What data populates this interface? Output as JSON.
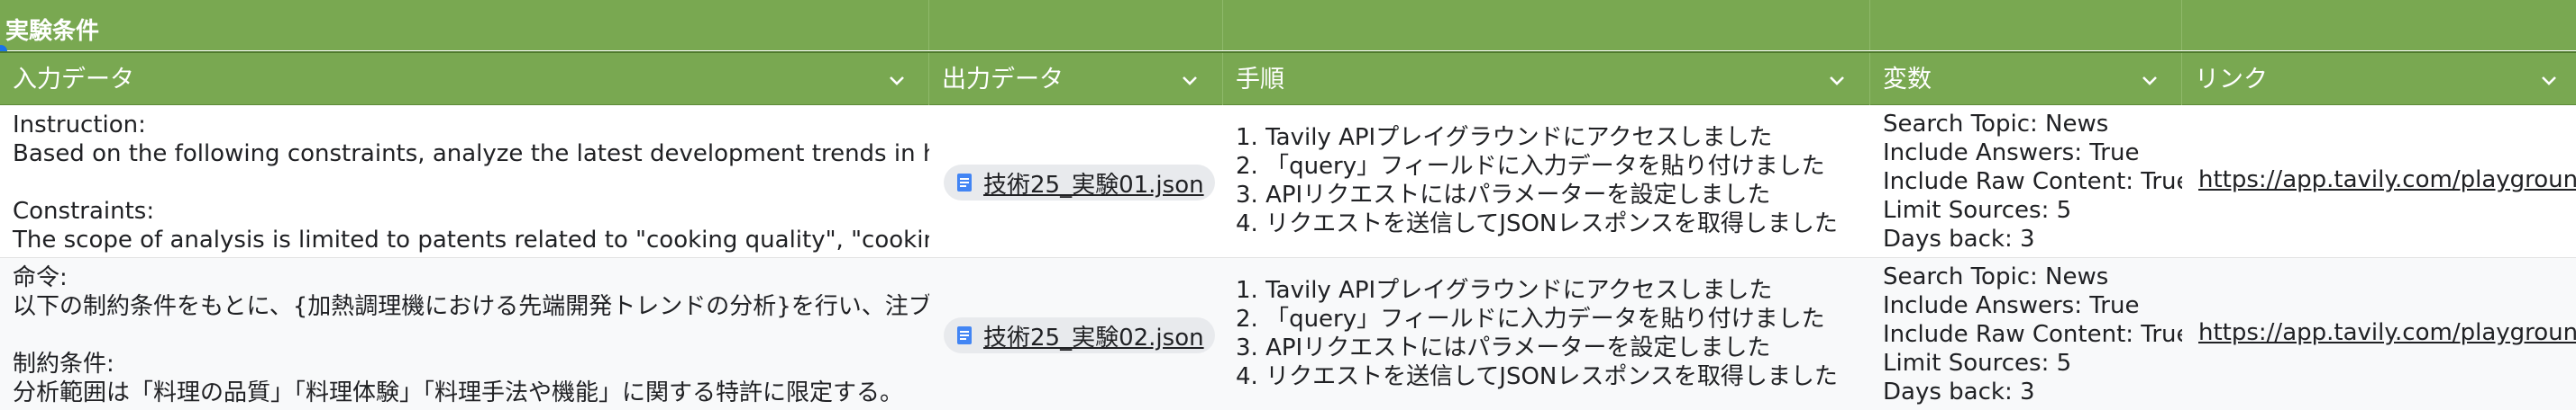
{
  "sheet": {
    "section_title": "実験条件",
    "header_bg": "#79a851",
    "columns": [
      {
        "label": "入力データ"
      },
      {
        "label": "出力データ"
      },
      {
        "label": "手順"
      },
      {
        "label": "変数"
      },
      {
        "label": "リンク"
      }
    ],
    "rows": [
      {
        "input_text": "Instruction:\nBased on the following constraints, analyze the latest development trends in heating c\n\nConstraints:\nThe scope of analysis is limited to patents related to \"cooking quality\", \"cooking experi",
        "output_file": "技術25_実験01.json",
        "steps": "1. Tavily APIプレイグラウンドにアクセスしました\n2. 「query」フィールドに入力データを貼り付けました\n3. APIリクエストにはパラメーターを設定しました\n4. リクエストを送信してJSONレスポンスを取得しました",
        "variables": "Search Topic: News\nInclude Answers: True\nInclude Raw Content: True\nLimit Sources: 5\nDays back: 3",
        "link": "https://app.tavily.com/playground"
      },
      {
        "input_text": "命令:\n以下の制約条件をもとに、{加熱調理機における先端開発トレンドの分析}を行い、注ブ\n\n制約条件:\n分析範囲は「料理の品質」「料理体験」「料理手法や機能」に関する特許に限定する。",
        "output_file": "技術25_実験02.json",
        "steps": "1. Tavily APIプレイグラウンドにアクセスしました\n2. 「query」フィールドに入力データを貼り付けました\n3. APIリクエストにはパラメーターを設定しました\n4. リクエストを送信してJSONレスポンスを取得しました",
        "variables": "Search Topic: News\nInclude Answers: True\nInclude Raw Content: True\nLimit Sources: 5\nDays back: 3",
        "link": "https://app.tavily.com/playground"
      }
    ]
  }
}
